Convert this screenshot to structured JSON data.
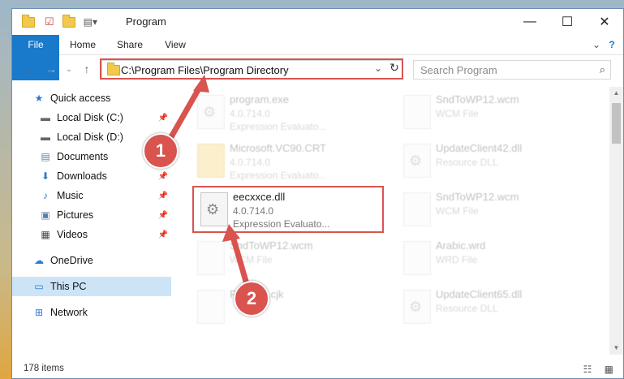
{
  "window": {
    "title": "Program",
    "minimize": "—",
    "maximize": "☐",
    "close": "✕"
  },
  "ribbon": {
    "tabs": [
      "File",
      "Home",
      "Share",
      "View"
    ],
    "help": "?",
    "expand": "⌄"
  },
  "nav": {
    "back": "←",
    "forward": "→",
    "up": "↑",
    "address": "C:\\Program Files\\Program Directory",
    "dropdown": "⌄",
    "refresh": "↻",
    "search_placeholder": "Search Program",
    "search_icon": "⌕"
  },
  "sidebar": [
    {
      "label": "Quick access",
      "icon": "star-icon",
      "pinned": false
    },
    {
      "label": "Local Disk (C:)",
      "icon": "drive-icon",
      "pinned": true
    },
    {
      "label": "Local Disk (D:)",
      "icon": "drive-icon",
      "pinned": false
    },
    {
      "label": "Documents",
      "icon": "documents-icon",
      "pinned": false
    },
    {
      "label": "Downloads",
      "icon": "download-icon",
      "pinned": true
    },
    {
      "label": "Music",
      "icon": "music-icon",
      "pinned": true
    },
    {
      "label": "Pictures",
      "icon": "pictures-icon",
      "pinned": true
    },
    {
      "label": "Videos",
      "icon": "videos-icon",
      "pinned": true
    },
    {
      "label": "OneDrive",
      "icon": "cloud-icon",
      "pinned": false
    },
    {
      "label": "This PC",
      "icon": "pc-icon",
      "pinned": false,
      "selected": true
    },
    {
      "label": "Network",
      "icon": "network-icon",
      "pinned": false
    }
  ],
  "files": [
    {
      "name": "program.exe",
      "line2": "4.0.714.0",
      "line3": "Expression Evaluato...",
      "highlighted": false
    },
    {
      "name": "Microsoft.VC90.CRT",
      "line2": "4.0.714.0",
      "line3": "Expression Evaluato...",
      "highlighted": false
    },
    {
      "name": "eecxxce.dll",
      "line2": "4.0.714.0",
      "line3": "Expression Evaluato...",
      "highlighted": true
    },
    {
      "name": "SndToWP12.wcm",
      "line2": "WCM File",
      "line3": "",
      "highlighted": false
    },
    {
      "name": "Fontstat.cjk",
      "line2": "",
      "line3": "",
      "highlighted": false
    },
    {
      "name": "SndToWP12.wcm",
      "line2": "WCM File",
      "line3": "",
      "highlighted": false
    },
    {
      "name": "UpdateClient42.dll",
      "line2": "Resource DLL",
      "line3": "",
      "highlighted": false
    },
    {
      "name": "SndToWP12.wcm",
      "line2": "WCM File",
      "line3": "",
      "highlighted": false
    },
    {
      "name": "Arabic.wrd",
      "line2": "WRD File",
      "line3": "",
      "highlighted": false
    },
    {
      "name": "UpdateClient65.dll",
      "line2": "Resource DLL",
      "line3": "",
      "highlighted": false
    }
  ],
  "status": {
    "item_count": "178 items",
    "views": "☷ ▦"
  },
  "callouts": [
    "1",
    "2"
  ],
  "colors": {
    "accent": "#1979ca",
    "highlight": "#d9534f",
    "selected": "#cde4f7"
  }
}
